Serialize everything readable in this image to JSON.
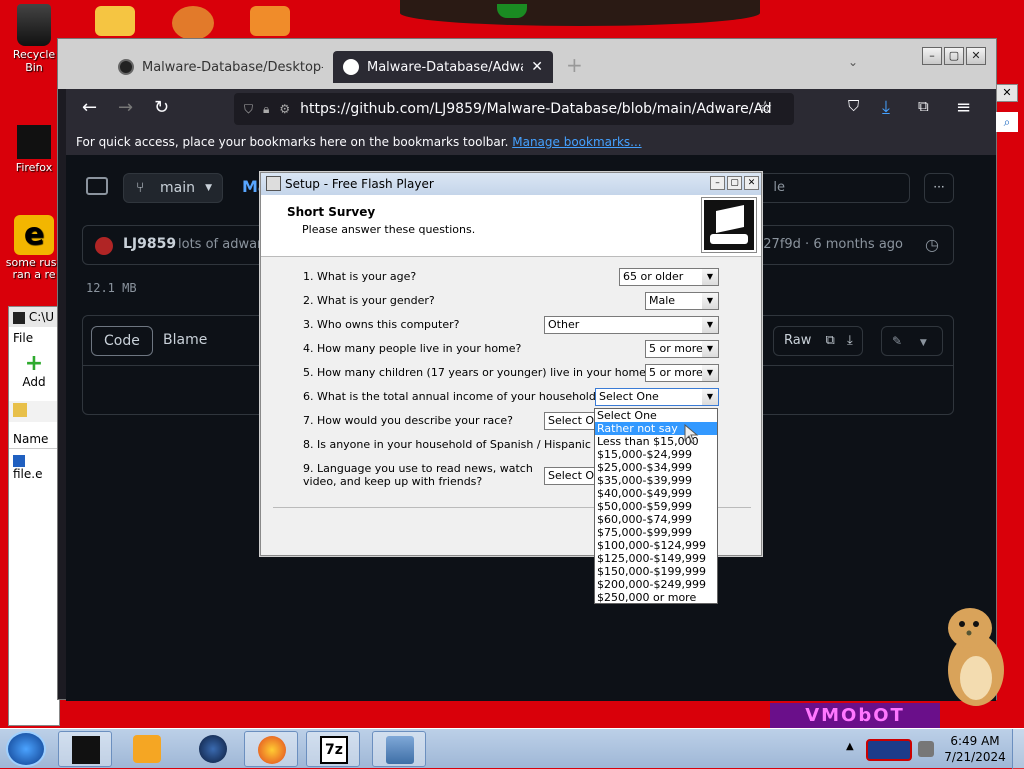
{
  "desktop": {
    "icons": [
      {
        "label": "Recycle Bin"
      },
      {
        "label": "Firefox"
      },
      {
        "label": "some russ ran a re"
      }
    ]
  },
  "browser": {
    "tabs": [
      {
        "label": "Malware-Database/Desktop-Bu"
      },
      {
        "label": "Malware-Database/Adware/Ad"
      }
    ],
    "url": "https://github.com/LJ9859/Malware-Database/blob/main/Adware/Ad",
    "bookmarks_text": "For quick access, place your bookmarks here on the bookmarks toolbar.",
    "bookmarks_link": "Manage bookmarks..."
  },
  "github": {
    "branch": "main",
    "repo_partial": "Ma",
    "search_partial": "le",
    "commit_author": "LJ9859",
    "commit_message": "lots of adware",
    "commit_meta": "c227f9d · 6 months ago",
    "file_size": "12.1 MB",
    "tab_code": "Code",
    "tab_blame": "Blame",
    "raw": "Raw"
  },
  "sevenzip": {
    "title": "C:\\U",
    "menu_file": "File",
    "add": "Add",
    "col_name": "Name",
    "file": "file.e"
  },
  "setup": {
    "title": "Setup - Free Flash Player",
    "heading": "Short Survey",
    "subheading": "Please answer these questions.",
    "questions": [
      {
        "label": "1. What is your age?",
        "value": "65 or older"
      },
      {
        "label": "2. What is your gender?",
        "value": "Male"
      },
      {
        "label": "3. Who owns this computer?",
        "value": "Other"
      },
      {
        "label": "4. How many people live in your home?",
        "value": "5 or more"
      },
      {
        "label": "5. How many children (17 years or younger) live in your home?",
        "value": "5 or more"
      },
      {
        "label": "6. What is the total annual income of your household?",
        "value": "Select One"
      },
      {
        "label": "7. How would you describe your race?",
        "value": "Select One"
      },
      {
        "label": "8. Is anyone in your household of Spanish / Hispanic descent",
        "value": ""
      },
      {
        "label_line1": "9. Language you use to read news, watch",
        "label_line2": "video, and keep up with friends?",
        "value": "Select One"
      }
    ],
    "dropdown_options": [
      "Select One",
      "Rather not say",
      "Less than $15,000",
      "$15,000-$24,999",
      "$25,000-$34,999",
      "$35,000-$39,999",
      "$40,000-$49,999",
      "$50,000-$59,999",
      "$60,000-$74,999",
      "$75,000-$99,999",
      "$100,000-$124,999",
      "$125,000-$149,999",
      "$150,000-$199,999",
      "$200,000-$249,999",
      "$250,000 or more"
    ],
    "highlighted_option": "Rather not say"
  },
  "bottom": {
    "purple_banner": "VMObOT"
  },
  "taskbar": {
    "time": "6:49 AM",
    "date": "7/21/2024",
    "apps": [
      "7z-icon"
    ]
  },
  "colors": {
    "desktop_bg": "#d9000a",
    "github_bg": "#0d1117",
    "link": "#45a1ff",
    "highlight": "#3399ff"
  }
}
